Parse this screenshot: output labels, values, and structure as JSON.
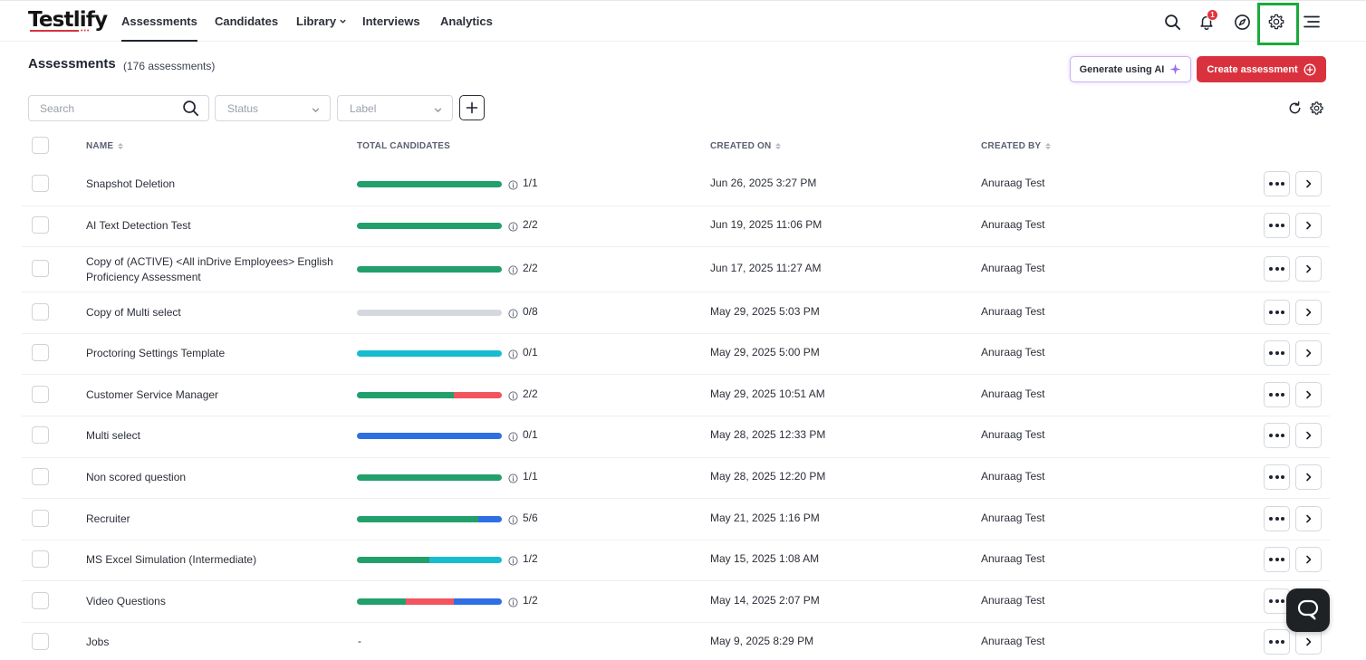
{
  "brand": {
    "name": "Testlify",
    "dots": "•••"
  },
  "nav": {
    "links": [
      "Assessments",
      "Candidates",
      "Library",
      "Interviews",
      "Analytics"
    ],
    "notifications_count": "1"
  },
  "header": {
    "title": "Assessments",
    "count": "(176 assessments)",
    "generate_ai_label": "Generate using AI",
    "create_label": "Create assessment"
  },
  "filters": {
    "search_placeholder": "Search",
    "status_placeholder": "Status",
    "label_placeholder": "Label"
  },
  "table": {
    "columns": [
      "NAME",
      "TOTAL CANDIDATES",
      "CREATED ON",
      "CREATED BY"
    ],
    "rows": [
      {
        "name": "Snapshot Deletion",
        "ratio": "1/1",
        "created_on": "Jun 26, 2025 3:27 PM",
        "created_by": "Anuraag Test",
        "bar": [
          {
            "color": "#22a06b",
            "fraction": 1
          }
        ]
      },
      {
        "name": "AI Text Detection Test",
        "ratio": "2/2",
        "created_on": "Jun 19, 2025 11:06 PM",
        "created_by": "Anuraag Test",
        "bar": [
          {
            "color": "#22a06b",
            "fraction": 1
          }
        ]
      },
      {
        "name": "Copy of (ACTIVE) <All inDrive Employees> English Proficiency Assessment",
        "ratio": "2/2",
        "created_on": "Jun 17, 2025 11:27 AM",
        "created_by": "Anuraag Test",
        "bar": [
          {
            "color": "#22a06b",
            "fraction": 1
          }
        ]
      },
      {
        "name": "Copy of Multi select",
        "ratio": "0/8",
        "created_on": "May 29, 2025 5:03 PM",
        "created_by": "Anuraag Test",
        "bar": []
      },
      {
        "name": "Proctoring Settings Template",
        "ratio": "0/1",
        "created_on": "May 29, 2025 5:00 PM",
        "created_by": "Anuraag Test",
        "bar": [
          {
            "color": "#17bcd0",
            "fraction": 1
          }
        ]
      },
      {
        "name": "Customer Service Manager",
        "ratio": "2/2",
        "created_on": "May 29, 2025 10:51 AM",
        "created_by": "Anuraag Test",
        "bar": [
          {
            "color": "#22a06b",
            "fraction": 0.67
          },
          {
            "color": "#f2555e",
            "fraction": 0.33
          }
        ]
      },
      {
        "name": "Multi select",
        "ratio": "0/1",
        "created_on": "May 28, 2025 12:33 PM",
        "created_by": "Anuraag Test",
        "bar": [
          {
            "color": "#2f6fe4",
            "fraction": 1
          }
        ]
      },
      {
        "name": "Non scored question",
        "ratio": "1/1",
        "created_on": "May 28, 2025 12:20 PM",
        "created_by": "Anuraag Test",
        "bar": [
          {
            "color": "#22a06b",
            "fraction": 1
          }
        ]
      },
      {
        "name": "Recruiter",
        "ratio": "5/6",
        "created_on": "May 21, 2025 1:16 PM",
        "created_by": "Anuraag Test",
        "bar": [
          {
            "color": "#22a06b",
            "fraction": 0.84
          },
          {
            "color": "#2f6fe4",
            "fraction": 0.16
          }
        ]
      },
      {
        "name": "MS Excel Simulation (Intermediate)",
        "ratio": "1/2",
        "created_on": "May 15, 2025 1:08 AM",
        "created_by": "Anuraag Test",
        "bar": [
          {
            "color": "#22a06b",
            "fraction": 0.5
          },
          {
            "color": "#17bcd0",
            "fraction": 0.5
          }
        ]
      },
      {
        "name": "Video Questions",
        "ratio": "1/2",
        "created_on": "May 14, 2025 2:07 PM",
        "created_by": "Anuraag Test",
        "bar": [
          {
            "color": "#22a06b",
            "fraction": 0.34
          },
          {
            "color": "#f2555e",
            "fraction": 0.33
          },
          {
            "color": "#2f6fe4",
            "fraction": 0.33
          }
        ]
      },
      {
        "name": "Jobs",
        "ratio": "",
        "dash": "-",
        "created_on": "May 9, 2025 8:29 PM",
        "created_by": "Anuraag Test",
        "bar": null
      }
    ]
  }
}
